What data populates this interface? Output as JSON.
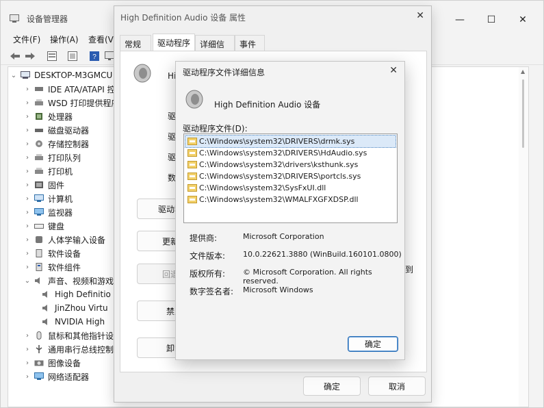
{
  "devmgr": {
    "title": "设备管理器",
    "window_controls": {
      "minimize": "—",
      "maximize": "☐",
      "close": "✕"
    },
    "menu": [
      "文件(F)",
      "操作(A)",
      "查看(V)"
    ],
    "tree": {
      "root": "DESKTOP-M3GMCU",
      "items": [
        {
          "label": "IDE ATA/ATAPI 控",
          "expanded": false
        },
        {
          "label": "WSD 打印提供程序",
          "expanded": false
        },
        {
          "label": "处理器",
          "expanded": false
        },
        {
          "label": "磁盘驱动器",
          "expanded": false
        },
        {
          "label": "存储控制器",
          "expanded": false
        },
        {
          "label": "打印队列",
          "expanded": false
        },
        {
          "label": "打印机",
          "expanded": false
        },
        {
          "label": "固件",
          "expanded": false
        },
        {
          "label": "计算机",
          "expanded": false
        },
        {
          "label": "监视器",
          "expanded": false
        },
        {
          "label": "键盘",
          "expanded": false
        },
        {
          "label": "人体学输入设备",
          "expanded": false
        },
        {
          "label": "软件设备",
          "expanded": false
        },
        {
          "label": "软件组件",
          "expanded": false
        },
        {
          "label": "声音、视频和游戏控",
          "expanded": true
        },
        {
          "label": "High Definitio",
          "child": true
        },
        {
          "label": "JinZhou Virtu",
          "child": true
        },
        {
          "label": "NVIDIA High",
          "child": true
        },
        {
          "label": "鼠标和其他指针设",
          "expanded": false
        },
        {
          "label": "通用串行总线控制",
          "expanded": false
        },
        {
          "label": "图像设备",
          "expanded": false
        },
        {
          "label": "网络适配器",
          "expanded": false
        }
      ]
    }
  },
  "props": {
    "title": "High Definition Audio 设备 属性",
    "tabs": [
      "常规",
      "驱动程序",
      "详细信息",
      "事件"
    ],
    "device_short": "Hi",
    "labels": [
      "驱动",
      "驱动",
      "驱动",
      "数字"
    ],
    "buttons": [
      "驱动程序",
      "更新驱",
      "回退驱",
      "禁用",
      "卸载"
    ],
    "side_text": "到",
    "ok": "确定",
    "cancel": "取消"
  },
  "details": {
    "title": "驱动程序文件详细信息",
    "device_name": "High Definition Audio 设备",
    "files_label": "驱动程序文件(D):",
    "files": [
      "C:\\Windows\\system32\\DRIVERS\\drmk.sys",
      "C:\\Windows\\system32\\DRIVERS\\HdAudio.sys",
      "C:\\Windows\\system32\\drivers\\ksthunk.sys",
      "C:\\Windows\\system32\\DRIVERS\\portcls.sys",
      "C:\\Windows\\system32\\SysFxUI.dll",
      "C:\\Windows\\system32\\WMALFXGFXDSP.dll"
    ],
    "selected_index": 0,
    "info": {
      "provider_label": "提供商:",
      "provider_value": "Microsoft Corporation",
      "version_label": "文件版本:",
      "version_value": "10.0.22621.3880 (WinBuild.160101.0800)",
      "copyright_label": "版权所有:",
      "copyright_value": "© Microsoft Corporation. All rights reserved.",
      "signer_label": "数字签名者:",
      "signer_value": "Microsoft Windows"
    },
    "ok": "确定",
    "close_glyph": "✕"
  }
}
